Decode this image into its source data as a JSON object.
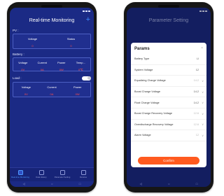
{
  "left_screen": {
    "title": "Real-time Monitoring",
    "add_label": "+",
    "pv": {
      "label": "PV :",
      "columns": [
        {
          "key": "Voltage",
          "value": "0"
        },
        {
          "key": "Status",
          "value": "0"
        }
      ]
    },
    "battery": {
      "label": "Battery :",
      "columns": [
        {
          "key": "Voltage",
          "value": "0V"
        },
        {
          "key": "Current",
          "value": "0A"
        },
        {
          "key": "Power",
          "value": "0W"
        },
        {
          "key": "Temp...",
          "value": "0℃"
        }
      ]
    },
    "load": {
      "label": "Load :",
      "toggle_on": true,
      "columns": [
        {
          "key": "Voltage",
          "value": "0V"
        },
        {
          "key": "Current",
          "value": "0A"
        },
        {
          "key": "Power",
          "value": "0W"
        }
      ]
    },
    "tabs": [
      {
        "label": "Real-time Monitoring",
        "active": true,
        "icon": "monitor-icon"
      },
      {
        "label": "Data History",
        "active": false,
        "icon": "chart-icon"
      },
      {
        "label": "Parameter Setting",
        "active": false,
        "icon": "settings-icon"
      },
      {
        "label": "Devices",
        "active": false,
        "icon": "device-icon"
      }
    ],
    "nav": {
      "back": "◁",
      "home": "○",
      "recent": "□"
    }
  },
  "right_screen": {
    "title": "Parameter Setting",
    "dialog": {
      "title": "Params",
      "close": "×",
      "rows": [
        {
          "name": "Battery Type",
          "value": "LI",
          "dim": false,
          "chevron": ""
        },
        {
          "name": "System Voltage",
          "value": "12",
          "dim": false,
          "chevron": ""
        },
        {
          "name": "Equalizing Charge Voltage",
          "value": "14.2",
          "dim": true,
          "chevron": "∨"
        },
        {
          "name": "Boost Charge Voltage",
          "value": "14.2",
          "dim": false,
          "chevron": "∨"
        },
        {
          "name": "Float Charge Voltage",
          "value": "14.2",
          "dim": false,
          "chevron": "∨"
        },
        {
          "name": "Boost Charge Recovery Voltage",
          "value": "12.6",
          "dim": true,
          "chevron": "∨"
        },
        {
          "name": "Overdischarge Recovery Voltage",
          "value": "12.6",
          "dim": true,
          "chevron": "∨"
        },
        {
          "name": "Alarm Voltage",
          "value": "12",
          "dim": true,
          "chevron": "∨"
        }
      ],
      "confirm_label": "Confirm"
    },
    "nav": {
      "back": "◁",
      "home": "○",
      "recent": "□"
    }
  },
  "colors": {
    "app_background": "#1b2a85",
    "value_red": "#ff4d4d",
    "active_blue": "#4f9bff",
    "confirm_orange": "#ff5a1f"
  }
}
